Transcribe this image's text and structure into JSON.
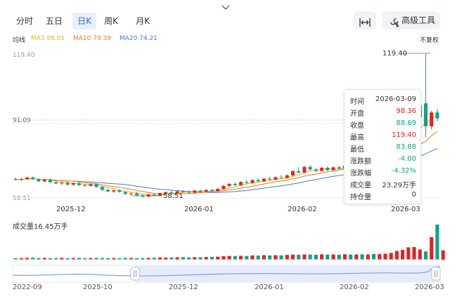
{
  "collapse_icon": "chevron-down-icon",
  "tabs": [
    {
      "label": "分时",
      "active": false
    },
    {
      "label": "五日",
      "active": false
    },
    {
      "label": "日K",
      "active": true
    },
    {
      "label": "周K",
      "active": false
    },
    {
      "label": "月K",
      "active": false
    }
  ],
  "toolbar": {
    "fit_icon": "fit-width-icon",
    "advanced_icon": "tool-icon",
    "advanced_label": "高级工具"
  },
  "ma": {
    "title": "均线",
    "ma5": "MA5 86.01",
    "ma10": "MA10 79.39",
    "ma20": "MA20 74.21",
    "colors": {
      "ma5": "#f0b400",
      "ma10": "#f07a1a",
      "ma20": "#4a78d8"
    }
  },
  "adjust_label": "不复权",
  "colors": {
    "up": "#e02424",
    "down": "#13a089",
    "accent": "#2f6bd8"
  },
  "price_axis": {
    "top": "119.40",
    "mid": "91.09",
    "bottom": "58.51"
  },
  "annotations": {
    "high": "119.40",
    "low": "58.51"
  },
  "x_labels": [
    "2025-12",
    "2026-01",
    "2026-02",
    "2026-03"
  ],
  "tooltip": {
    "rows": [
      {
        "key": "时间",
        "value": "2026-03-09",
        "tone": "neutral"
      },
      {
        "key": "开盘",
        "value": "98.36",
        "tone": "up"
      },
      {
        "key": "收盘",
        "value": "88.69",
        "tone": "down"
      },
      {
        "key": "最高",
        "value": "119.40",
        "tone": "up"
      },
      {
        "key": "最低",
        "value": "83.88",
        "tone": "down"
      },
      {
        "key": "涨跌额",
        "value": "-4.00",
        "tone": "down"
      },
      {
        "key": "涨跌幅",
        "value": "-4.32%",
        "tone": "down"
      },
      {
        "key": "成交量",
        "value": "23.29万手",
        "tone": "neutral"
      },
      {
        "key": "持仓量",
        "value": "0",
        "tone": "neutral"
      }
    ]
  },
  "volume_label": "成交量16.45万手",
  "navigator_labels": [
    "2022-09",
    "2025-10",
    "2025-12",
    "2026-01",
    "2026-02",
    "2026-03"
  ],
  "chart_data": {
    "type": "candlestick",
    "y_range": [
      58.51,
      119.4
    ],
    "candles": [
      {
        "o": 66.5,
        "h": 67.2,
        "l": 65.8,
        "c": 66.2
      },
      {
        "o": 66.2,
        "h": 66.9,
        "l": 65.6,
        "c": 66.5
      },
      {
        "o": 66.5,
        "h": 67.5,
        "l": 66.0,
        "c": 67.1
      },
      {
        "o": 67.1,
        "h": 67.6,
        "l": 66.2,
        "c": 66.4
      },
      {
        "o": 66.4,
        "h": 66.8,
        "l": 65.2,
        "c": 65.5
      },
      {
        "o": 65.5,
        "h": 66.6,
        "l": 65.1,
        "c": 66.3
      },
      {
        "o": 66.3,
        "h": 66.7,
        "l": 64.9,
        "c": 65.1
      },
      {
        "o": 65.1,
        "h": 65.6,
        "l": 64.2,
        "c": 64.6
      },
      {
        "o": 64.6,
        "h": 65.3,
        "l": 64.0,
        "c": 64.9
      },
      {
        "o": 64.9,
        "h": 65.4,
        "l": 63.9,
        "c": 64.1
      },
      {
        "o": 64.1,
        "h": 65.0,
        "l": 63.8,
        "c": 64.7
      },
      {
        "o": 64.7,
        "h": 65.2,
        "l": 63.6,
        "c": 63.9
      },
      {
        "o": 63.9,
        "h": 64.4,
        "l": 63.2,
        "c": 63.6
      },
      {
        "o": 63.6,
        "h": 64.6,
        "l": 63.3,
        "c": 64.3
      },
      {
        "o": 64.3,
        "h": 64.7,
        "l": 62.8,
        "c": 63.1
      },
      {
        "o": 63.1,
        "h": 63.6,
        "l": 61.5,
        "c": 61.9
      },
      {
        "o": 61.9,
        "h": 62.4,
        "l": 60.9,
        "c": 61.2
      },
      {
        "o": 61.2,
        "h": 62.0,
        "l": 60.6,
        "c": 61.7
      },
      {
        "o": 61.7,
        "h": 62.2,
        "l": 60.8,
        "c": 61.0
      },
      {
        "o": 61.0,
        "h": 61.4,
        "l": 59.8,
        "c": 60.2
      },
      {
        "o": 60.2,
        "h": 60.8,
        "l": 59.4,
        "c": 60.4
      },
      {
        "o": 60.4,
        "h": 60.9,
        "l": 59.2,
        "c": 59.6
      },
      {
        "o": 59.6,
        "h": 60.1,
        "l": 58.51,
        "c": 59.1
      },
      {
        "o": 59.1,
        "h": 60.3,
        "l": 58.9,
        "c": 59.9
      },
      {
        "o": 59.9,
        "h": 60.6,
        "l": 59.2,
        "c": 59.5
      },
      {
        "o": 59.5,
        "h": 60.8,
        "l": 59.3,
        "c": 60.5
      },
      {
        "o": 60.5,
        "h": 61.2,
        "l": 60.0,
        "c": 60.9
      },
      {
        "o": 60.9,
        "h": 61.5,
        "l": 60.3,
        "c": 60.6
      },
      {
        "o": 60.6,
        "h": 61.6,
        "l": 60.2,
        "c": 61.3
      },
      {
        "o": 61.3,
        "h": 61.8,
        "l": 60.7,
        "c": 61.0
      },
      {
        "o": 61.0,
        "h": 61.5,
        "l": 60.4,
        "c": 60.7
      },
      {
        "o": 60.7,
        "h": 61.9,
        "l": 60.5,
        "c": 61.6
      },
      {
        "o": 61.6,
        "h": 62.0,
        "l": 60.9,
        "c": 61.2
      },
      {
        "o": 61.2,
        "h": 62.1,
        "l": 60.8,
        "c": 61.9
      },
      {
        "o": 61.9,
        "h": 62.3,
        "l": 61.0,
        "c": 61.4
      },
      {
        "o": 61.4,
        "h": 62.6,
        "l": 61.1,
        "c": 62.3
      },
      {
        "o": 62.3,
        "h": 63.9,
        "l": 62.0,
        "c": 63.6
      },
      {
        "o": 63.6,
        "h": 64.8,
        "l": 63.1,
        "c": 64.4
      },
      {
        "o": 64.4,
        "h": 65.1,
        "l": 63.6,
        "c": 63.9
      },
      {
        "o": 63.9,
        "h": 65.6,
        "l": 63.7,
        "c": 65.2
      },
      {
        "o": 65.2,
        "h": 66.1,
        "l": 64.5,
        "c": 64.8
      },
      {
        "o": 64.8,
        "h": 66.4,
        "l": 64.6,
        "c": 66.0
      },
      {
        "o": 66.0,
        "h": 66.8,
        "l": 65.2,
        "c": 65.5
      },
      {
        "o": 65.5,
        "h": 66.9,
        "l": 65.3,
        "c": 66.6
      },
      {
        "o": 66.6,
        "h": 67.4,
        "l": 65.9,
        "c": 66.2
      },
      {
        "o": 66.2,
        "h": 67.6,
        "l": 66.0,
        "c": 67.2
      },
      {
        "o": 67.2,
        "h": 68.1,
        "l": 66.6,
        "c": 66.9
      },
      {
        "o": 66.9,
        "h": 68.4,
        "l": 66.7,
        "c": 68.0
      },
      {
        "o": 68.0,
        "h": 70.2,
        "l": 67.6,
        "c": 69.8
      },
      {
        "o": 69.8,
        "h": 71.4,
        "l": 68.9,
        "c": 69.2
      },
      {
        "o": 69.2,
        "h": 72.0,
        "l": 69.0,
        "c": 71.6
      },
      {
        "o": 71.6,
        "h": 72.4,
        "l": 70.1,
        "c": 70.5
      },
      {
        "o": 70.5,
        "h": 71.3,
        "l": 69.4,
        "c": 69.9
      },
      {
        "o": 69.9,
        "h": 71.6,
        "l": 69.7,
        "c": 71.2
      },
      {
        "o": 71.2,
        "h": 71.8,
        "l": 69.8,
        "c": 70.2
      },
      {
        "o": 70.2,
        "h": 71.7,
        "l": 70.0,
        "c": 71.4
      },
      {
        "o": 71.4,
        "h": 72.3,
        "l": 70.6,
        "c": 70.9
      },
      {
        "o": 70.9,
        "h": 72.5,
        "l": 70.7,
        "c": 72.1
      },
      {
        "o": 72.1,
        "h": 73.0,
        "l": 71.3,
        "c": 71.6
      },
      {
        "o": 71.6,
        "h": 73.2,
        "l": 71.4,
        "c": 72.9
      },
      {
        "o": 72.9,
        "h": 73.6,
        "l": 71.9,
        "c": 72.3
      },
      {
        "o": 72.3,
        "h": 73.8,
        "l": 72.1,
        "c": 73.4
      },
      {
        "o": 73.4,
        "h": 74.2,
        "l": 72.6,
        "c": 72.9
      },
      {
        "o": 72.9,
        "h": 74.5,
        "l": 72.7,
        "c": 74.1
      },
      {
        "o": 74.1,
        "h": 75.2,
        "l": 73.5,
        "c": 74.8
      },
      {
        "o": 74.8,
        "h": 76.4,
        "l": 74.5,
        "c": 76.0
      },
      {
        "o": 76.0,
        "h": 78.9,
        "l": 75.6,
        "c": 78.4
      },
      {
        "o": 78.4,
        "h": 83.5,
        "l": 77.8,
        "c": 82.9
      },
      {
        "o": 82.9,
        "h": 88.2,
        "l": 82.1,
        "c": 87.6
      },
      {
        "o": 87.6,
        "h": 93.0,
        "l": 86.3,
        "c": 92.4
      },
      {
        "o": 92.6,
        "h": 98.1,
        "l": 92.1,
        "c": 97.6
      },
      {
        "o": 98.36,
        "h": 119.4,
        "l": 83.88,
        "c": 88.69
      },
      {
        "o": 88.69,
        "h": 95.2,
        "l": 87.4,
        "c": 94.5
      },
      {
        "o": 94.5,
        "h": 96.0,
        "l": 90.8,
        "c": 92.0
      }
    ],
    "volume_label": "成交量16.45万手",
    "volumes": [
      1.0,
      1.1,
      1.2,
      1.3,
      1.1,
      1.2,
      1.0,
      1.1,
      1.2,
      1.0,
      1.1,
      1.2,
      1.0,
      1.1,
      1.2,
      1.1,
      1.0,
      1.1,
      1.0,
      1.2,
      1.1,
      1.0,
      1.1,
      1.2,
      1.3,
      1.5,
      1.4,
      1.5,
      1.6,
      1.7,
      1.5,
      1.7,
      1.6,
      1.8,
      1.9,
      2.0,
      2.3,
      2.5,
      2.4,
      2.6,
      2.5,
      2.8,
      2.7,
      3.0,
      2.8,
      3.0,
      2.9,
      3.2,
      3.4,
      3.3,
      3.5,
      3.4,
      3.3,
      3.6,
      3.4,
      3.5,
      3.3,
      3.6,
      3.4,
      3.5,
      3.6,
      3.5,
      3.8,
      3.7,
      4.0,
      4.5,
      5.8,
      6.5,
      8.2,
      8.4,
      6.8,
      5.5,
      15.0,
      23.29,
      6.2
    ]
  }
}
